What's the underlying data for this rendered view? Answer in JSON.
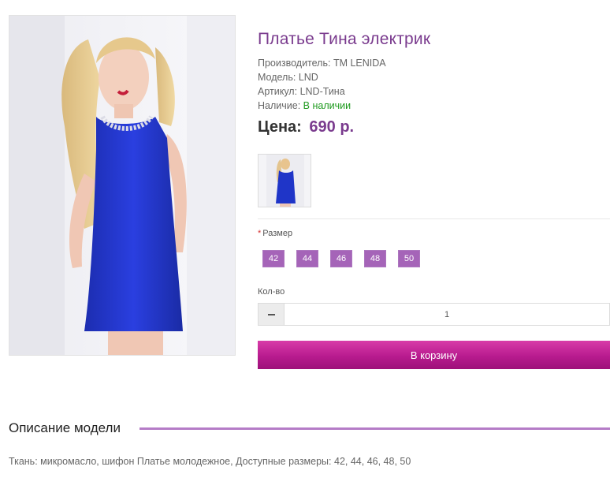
{
  "product": {
    "title": "Платье Тина электрик",
    "manufacturer_label": "Производитель:",
    "manufacturer": "TM LENIDA",
    "model_label": "Модель:",
    "model": "LND",
    "article_label": "Артикул:",
    "article": "LND-Тина",
    "availability_label": "Наличие:",
    "availability": "В наличии",
    "price_label": "Цена:",
    "price": "690 р."
  },
  "options": {
    "size_label": "Размер",
    "required_mark": "*",
    "sizes": [
      "42",
      "44",
      "46",
      "48",
      "50"
    ],
    "qty_label": "Кол-во",
    "qty_value": "1"
  },
  "actions": {
    "cart_button": "В корзину"
  },
  "description": {
    "title": "Описание модели",
    "text": "Ткань: микромасло, шифон Платье молодежное, Доступные размеры: 42, 44, 46, 48, 50"
  },
  "colors": {
    "accent": "#7a3b8e",
    "size_button": "#a564b8",
    "cart_button": "#b81b8f",
    "in_stock": "#1e9a1e"
  }
}
